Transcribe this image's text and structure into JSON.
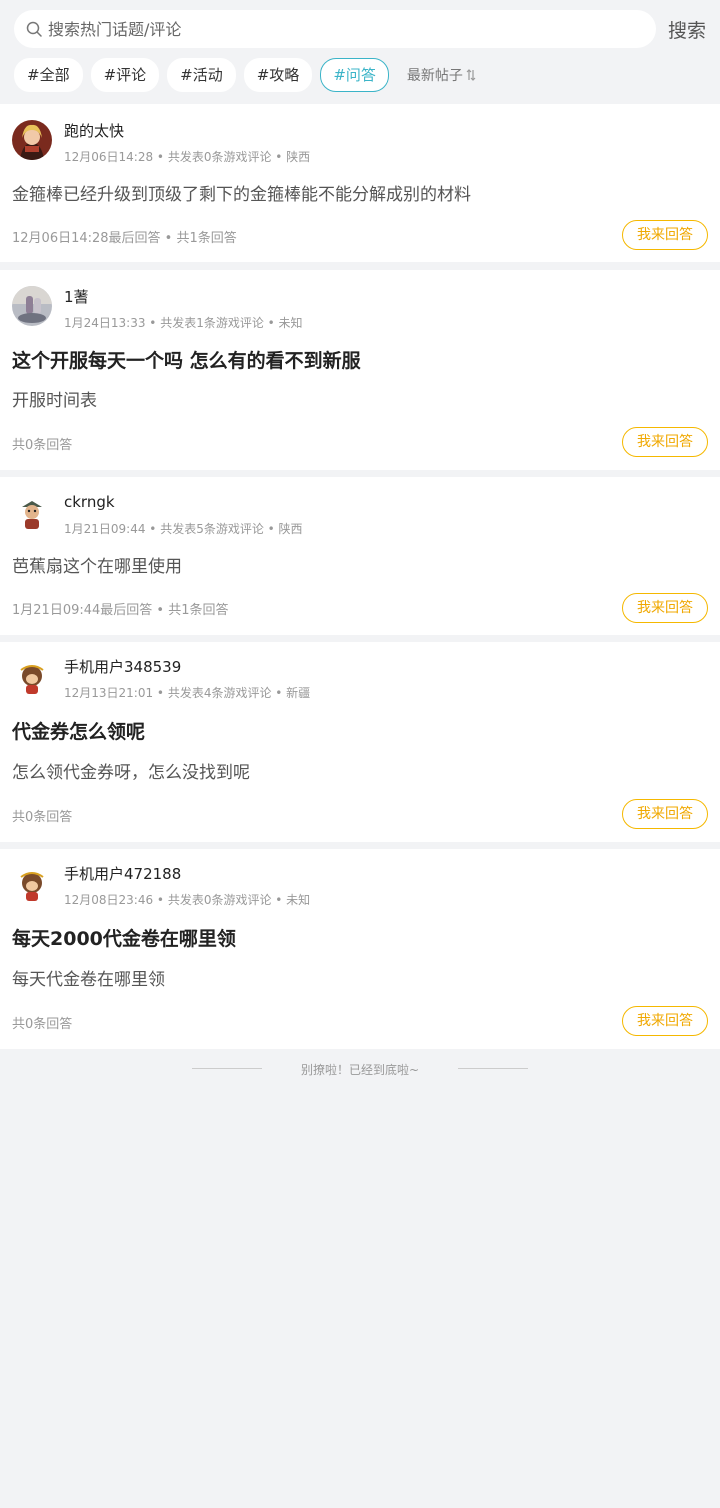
{
  "search": {
    "placeholder": "搜索热门话题/评论",
    "button_label": "搜索"
  },
  "tags": [
    {
      "label": "#全部",
      "active": false
    },
    {
      "label": "#评论",
      "active": false
    },
    {
      "label": "#活动",
      "active": false
    },
    {
      "label": "#攻略",
      "active": false
    },
    {
      "label": "#问答",
      "active": true
    }
  ],
  "sort": {
    "label": "最新帖子",
    "icon": "sort-arrows-icon"
  },
  "posts": [
    {
      "username": "跑的太快",
      "meta": "12月06日14:28 • 共发表0条游戏评论 • 陕西",
      "title": "",
      "content": "金箍棒已经升级到顶级了剩下的金箍棒能不能分解成别的材料",
      "footer": "12月06日14:28最后回答 • 共1条回答",
      "answer_label": "我来回答",
      "avatar": "avatar-warrior"
    },
    {
      "username": "1蓍",
      "meta": "1月24日13:33 • 共发表1条游戏评论 • 未知",
      "title": "这个开服每天一个吗 怎么有的看不到新服",
      "content": "开服时间表",
      "footer": "共0条回答",
      "answer_label": "我来回答",
      "avatar": "avatar-photo"
    },
    {
      "username": "ckrngk",
      "meta": "1月21日09:44 • 共发表5条游戏评论 • 陕西",
      "title": "",
      "content": "芭蕉扇这个在哪里使用",
      "footer": "1月21日09:44最后回答 • 共1条回答",
      "answer_label": "我来回答",
      "avatar": "avatar-character"
    },
    {
      "username": "手机用户348539",
      "meta": "12月13日21:01 • 共发表4条游戏评论 • 新疆",
      "title": "代金券怎么领呢",
      "content": "怎么领代金券呀，怎么没找到呢",
      "footer": "共0条回答",
      "answer_label": "我来回答",
      "avatar": "avatar-monkey"
    },
    {
      "username": "手机用户472188",
      "meta": "12月08日23:46 • 共发表0条游戏评论 • 未知",
      "title": "每天2000代金卷在哪里领",
      "content": "每天代金卷在哪里领",
      "footer": "共0条回答",
      "answer_label": "我来回答",
      "avatar": "avatar-monkey"
    }
  ],
  "end_message": "别撩啦！已经到底啦~",
  "colors": {
    "accent": "#3bb4c8",
    "answer_button": "#f5b800",
    "background": "#f2f3f5"
  }
}
